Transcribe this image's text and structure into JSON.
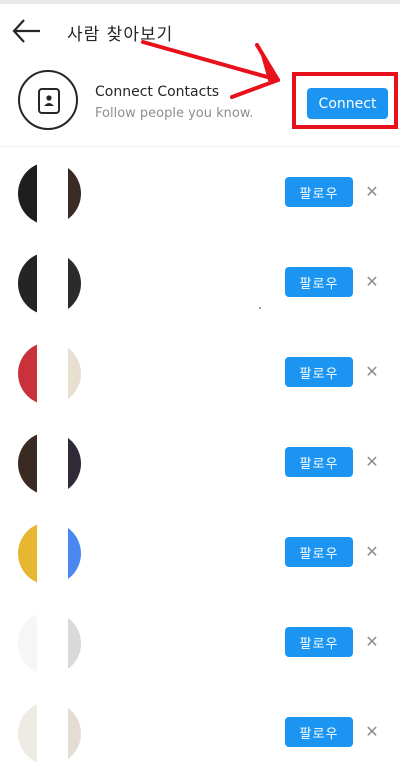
{
  "header": {
    "title": "사람 찾아보기",
    "back_icon": "arrow-left-icon"
  },
  "connect": {
    "title": "Connect Contacts",
    "subtitle": "Follow people you know.",
    "button_label": "Connect",
    "icon": "contact-card-icon"
  },
  "annotation": {
    "color": "#e8101b"
  },
  "colors": {
    "accent": "#1b95f1",
    "muted": "#8e8e8e"
  },
  "suggestions": [
    {
      "follow_label": "팔로우",
      "dismiss_icon": "close-icon",
      "avatar_left": "#1e1e1e",
      "avatar_right": "#3a2c24"
    },
    {
      "follow_label": "팔로우",
      "dismiss_icon": "close-icon",
      "avatar_left": "#242424",
      "avatar_right": "#2b2b2b"
    },
    {
      "follow_label": "팔로우",
      "dismiss_icon": "close-icon",
      "avatar_left": "#c9323a",
      "avatar_right": "#e7dfcf"
    },
    {
      "follow_label": "팔로우",
      "dismiss_icon": "close-icon",
      "avatar_left": "#3a2b22",
      "avatar_right": "#2f2a35"
    },
    {
      "follow_label": "팔로우",
      "dismiss_icon": "close-icon",
      "avatar_left": "#e8b731",
      "avatar_right": "#4b87f0"
    },
    {
      "follow_label": "팔로우",
      "dismiss_icon": "close-icon",
      "avatar_left": "#f6f6f6",
      "avatar_right": "#d9d9d9"
    },
    {
      "follow_label": "팔로우",
      "dismiss_icon": "close-icon",
      "avatar_left": "#eeeae4",
      "avatar_right": "#e3ddd3"
    }
  ]
}
